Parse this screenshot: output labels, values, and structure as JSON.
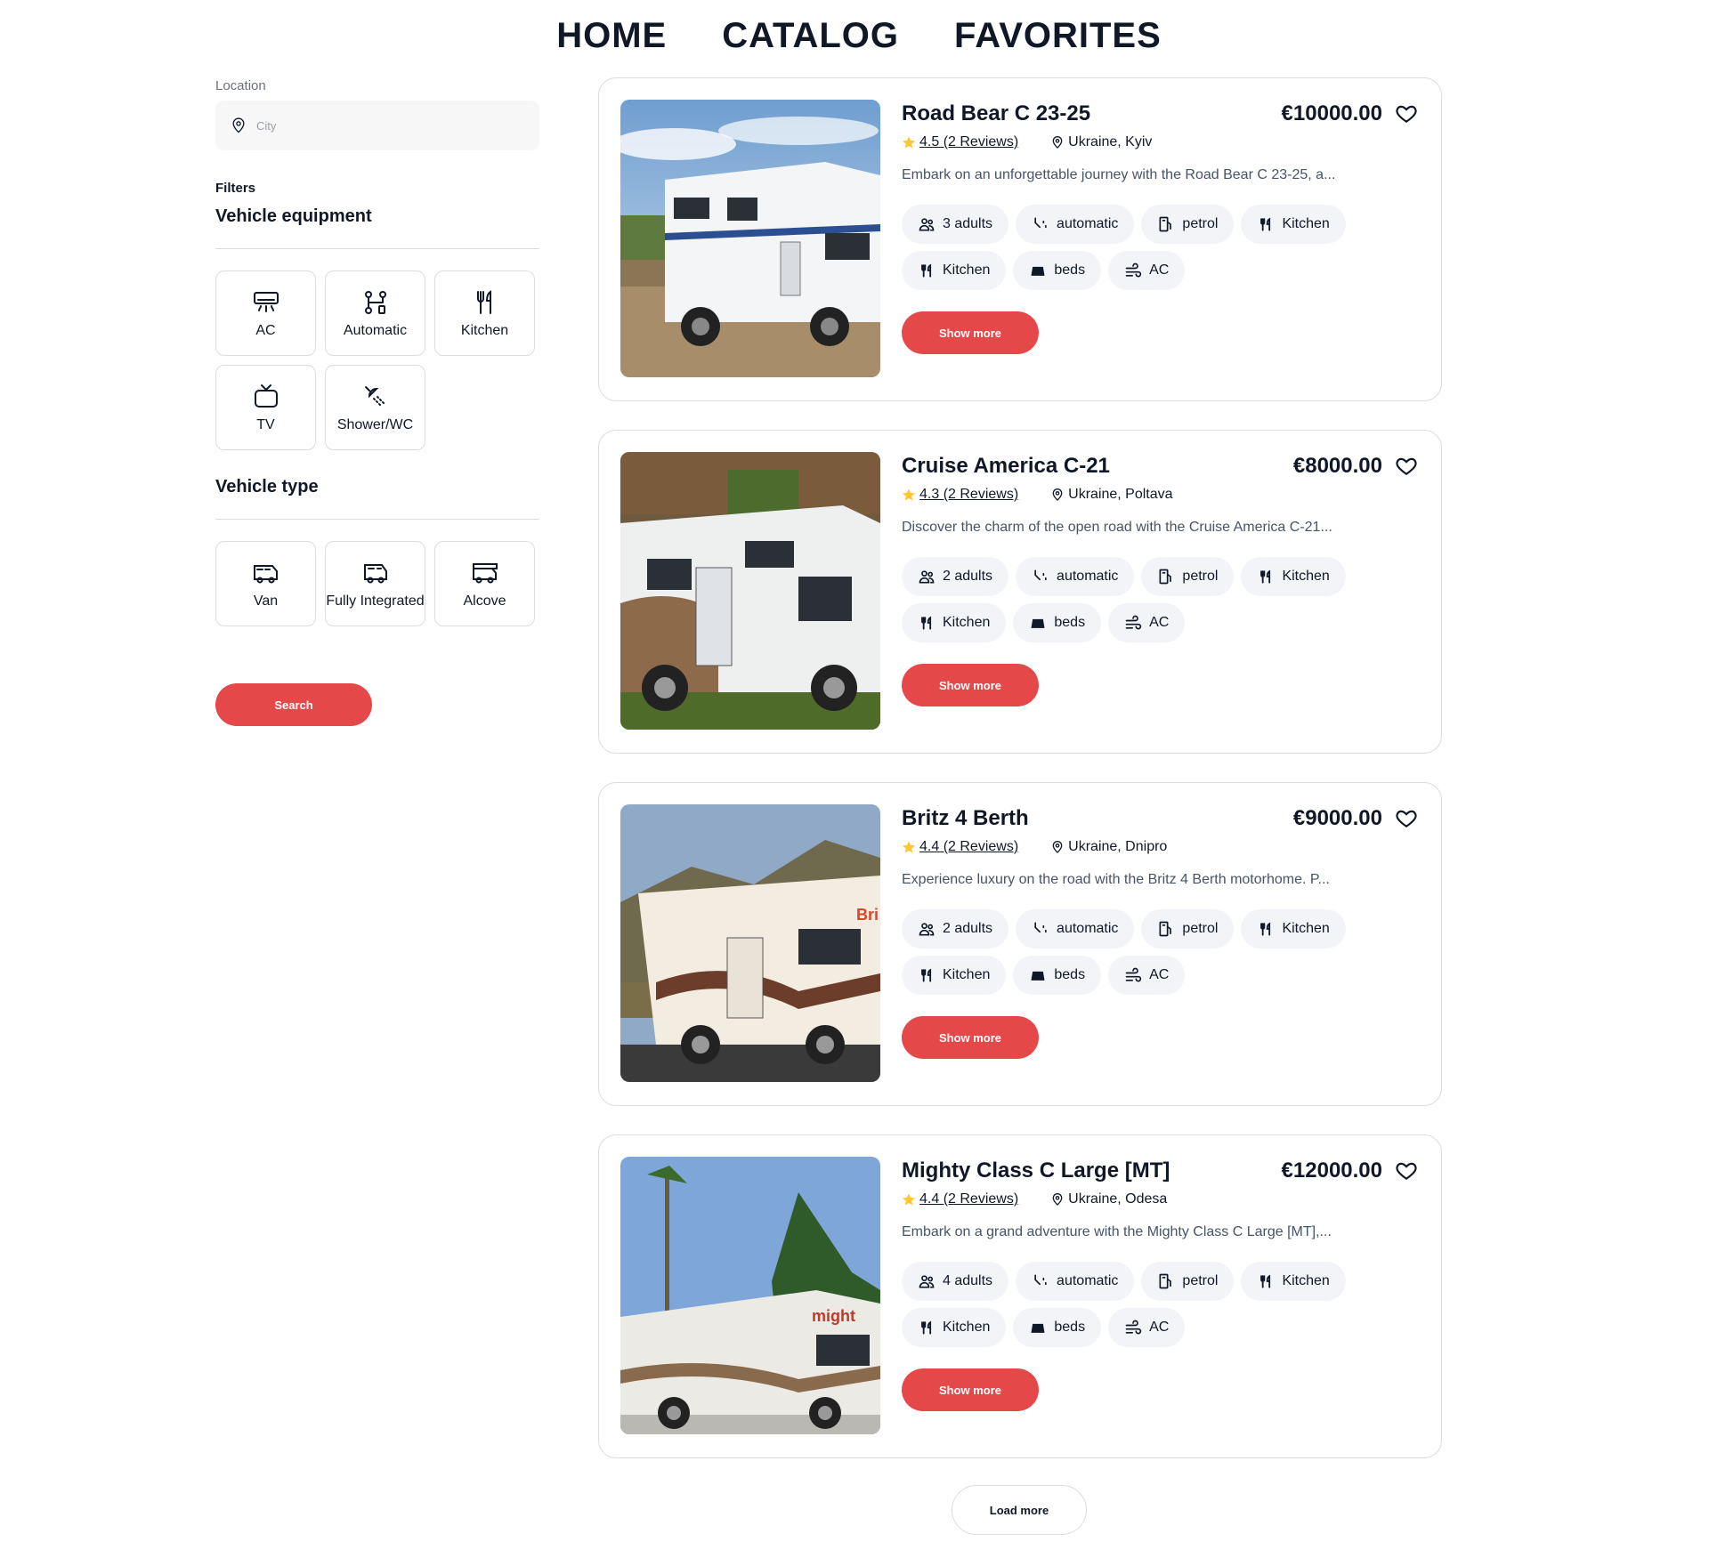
{
  "nav": {
    "home": "HOME",
    "catalog": "CATALOG",
    "favorites": "FAVORITES"
  },
  "sidebar": {
    "location_label": "Location",
    "location_placeholder": "City",
    "filters_label": "Filters",
    "equipment_title": "Vehicle equipment",
    "equipment": [
      {
        "label": "AC",
        "icon": "ac-icon"
      },
      {
        "label": "Automatic",
        "icon": "transmission-icon"
      },
      {
        "label": "Kitchen",
        "icon": "kitchen-icon"
      },
      {
        "label": "TV",
        "icon": "tv-icon"
      },
      {
        "label": "Shower/WC",
        "icon": "shower-icon"
      }
    ],
    "type_title": "Vehicle type",
    "types": [
      {
        "label": "Van",
        "icon": "van-icon"
      },
      {
        "label": "Fully Integrated",
        "icon": "fully-integrated-icon"
      },
      {
        "label": "Alcove",
        "icon": "alcove-icon"
      }
    ],
    "search_label": "Search"
  },
  "cards": [
    {
      "title": "Road Bear C 23-25",
      "price": "€10000.00",
      "rating": "4.5 (2 Reviews)",
      "location": "Ukraine, Kyiv",
      "description": "Embark on an unforgettable journey with the Road Bear C 23-25, a...",
      "chips": [
        "3 adults",
        "automatic",
        "petrol",
        "Kitchen",
        "Kitchen",
        "beds",
        "AC"
      ],
      "show_more": "Show more"
    },
    {
      "title": "Cruise America C-21",
      "price": "€8000.00",
      "rating": "4.3 (2 Reviews)",
      "location": "Ukraine, Poltava",
      "description": "Discover the charm of the open road with the Cruise America C-21...",
      "chips": [
        "2 adults",
        "automatic",
        "petrol",
        "Kitchen",
        "Kitchen",
        "beds",
        "AC"
      ],
      "show_more": "Show more"
    },
    {
      "title": "Britz 4 Berth",
      "price": "€9000.00",
      "rating": "4.4 (2 Reviews)",
      "location": "Ukraine, Dnipro",
      "description": "Experience luxury on the road with the Britz 4 Berth motorhome. P...",
      "chips": [
        "2 adults",
        "automatic",
        "petrol",
        "Kitchen",
        "Kitchen",
        "beds",
        "AC"
      ],
      "show_more": "Show more"
    },
    {
      "title": "Mighty Class C Large [MT]",
      "price": "€12000.00",
      "rating": "4.4 (2 Reviews)",
      "location": "Ukraine, Odesa",
      "description": "Embark on a grand adventure with the Mighty Class C Large [MT],...",
      "chips": [
        "4 adults",
        "automatic",
        "petrol",
        "Kitchen",
        "Kitchen",
        "beds",
        "AC"
      ],
      "show_more": "Show more"
    }
  ],
  "load_more": "Load more",
  "colors": {
    "accent": "#e44848",
    "star": "#ffc531",
    "chip_bg": "#f2f4f7",
    "border": "#dadde1"
  }
}
